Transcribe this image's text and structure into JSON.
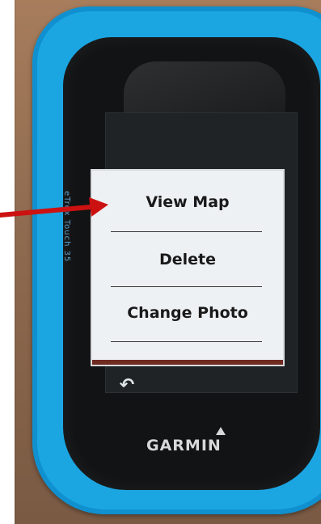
{
  "menu": {
    "items": [
      {
        "label": "View Map"
      },
      {
        "label": "Delete"
      },
      {
        "label": "Change Photo"
      }
    ]
  },
  "device": {
    "brand": "GARMIN",
    "back_icon": "back-arrow-icon",
    "side_label": "eTrex Touch 35"
  },
  "colors": {
    "case": "#1ba6e2",
    "screen_menu_bg": "#eef1f3",
    "annotation_arrow": "#cc1111"
  }
}
